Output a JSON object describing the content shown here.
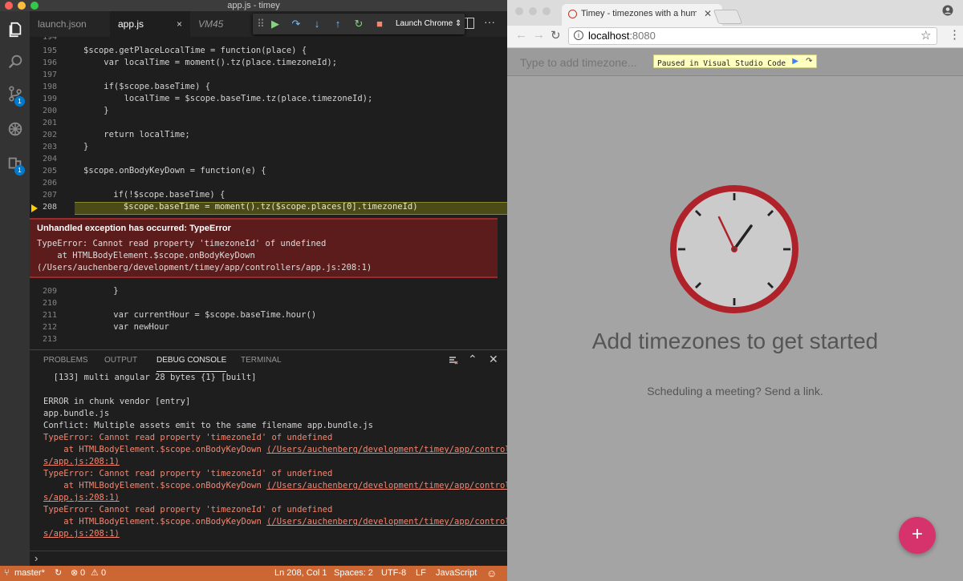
{
  "vscode": {
    "window_title": "app.js - timey",
    "tabs": [
      {
        "label": "launch.json",
        "active": false
      },
      {
        "label": "app.js",
        "active": true,
        "close": "×"
      },
      {
        "label": "VM45",
        "active": false
      }
    ],
    "debug_toolbar": {
      "launch_config": "Launch Chrome ⇕"
    },
    "activity_badges": {
      "scm": "1",
      "extensions": "1"
    },
    "line_numbers": [
      "194",
      "195",
      "196",
      "197",
      "198",
      "199",
      "200",
      "201",
      "202",
      "203",
      "204",
      "205",
      "206",
      "207",
      "208",
      "209",
      "210",
      "211",
      "212",
      "213"
    ],
    "code_lines": [
      "$scope.getPlaceLocalTime = function(place) {",
      "    var localTime = moment().tz(place.timezoneId);",
      "",
      "    if($scope.baseTime) {",
      "        localTime = $scope.baseTime.tz(place.timezoneId);",
      "    }",
      "",
      "    return localTime;",
      "}",
      "",
      "$scope.onBodyKeyDown = function(e) {",
      "",
      "    if(!$scope.baseTime) {",
      "      $scope.baseTime = moment().tz($scope.places[0].timezoneId)",
      "    }",
      "",
      "    var currentHour = $scope.baseTime.hour()",
      "    var newHour"
    ],
    "exception": {
      "title": "Unhandled exception has occurred: TypeError",
      "line1": "TypeError: Cannot read property 'timezoneId' of undefined",
      "line2": "    at HTMLBodyElement.$scope.onBodyKeyDown",
      "line3": "(/Users/auchenberg/development/timey/app/controllers/app.js:208:1)"
    },
    "panel_tabs": [
      "PROBLEMS",
      "OUTPUT",
      "DEBUG CONSOLE",
      "TERMINAL"
    ],
    "active_panel_tab": "DEBUG CONSOLE",
    "console": {
      "l1": "  [133] multi angular 28 bytes {1} [built]",
      "l2": "ERROR in chunk vendor [entry]",
      "l3": "app.bundle.js",
      "l4": "Conflict: Multiple assets emit to the same filename app.bundle.js",
      "error_text": "TypeError: Cannot read property 'timezoneId' of undefined",
      "at_text": "    at HTMLBodyElement.$scope.onBodyKeyDown ",
      "link_a": "(/Users/auchenberg/development/timey/app/controller",
      "link_b": "s/app.js:208:1)",
      "prompt": "›"
    },
    "status": {
      "branch": "master*",
      "errors": "0",
      "warnings": "0",
      "position": "Ln 208, Col 1",
      "spaces": "Spaces: 2",
      "encoding": "UTF-8",
      "eol": "LF",
      "language": "JavaScript",
      "smiley": "☺"
    },
    "colors": {
      "status_bar": "#cc6633",
      "accent": "#007acc",
      "exception_bg": "#5c1c1c"
    }
  },
  "chrome": {
    "tab_title": "Timey - timezones with a hum",
    "url_host": "localhost",
    "url_port": ":8080",
    "page": {
      "placeholder": "Type to add timezone...",
      "paused_text": "Paused in Visual Studio Code",
      "headline": "Add timezones to get started",
      "subline": "Scheduling a meeting? Send a link.",
      "fab": "+"
    },
    "colors": {
      "clock_ring": "#b0222a",
      "fab": "#d6336c",
      "paused_bg": "#ffffc0"
    }
  }
}
